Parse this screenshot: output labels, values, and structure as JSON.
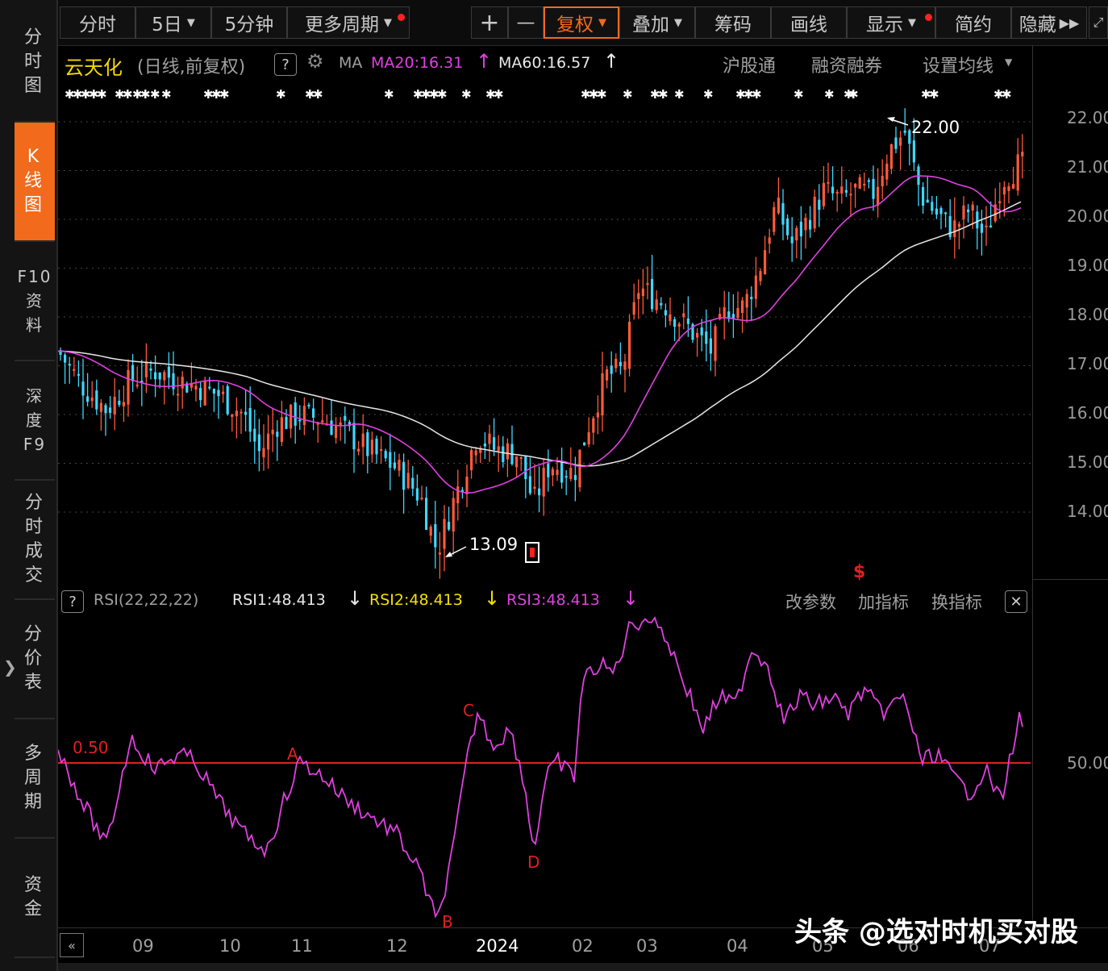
{
  "sidebar": {
    "items": [
      {
        "label": "分时图"
      },
      {
        "label": "K线图"
      },
      {
        "label": "F10资料"
      },
      {
        "label": "深度F9"
      },
      {
        "label": "分时成交"
      },
      {
        "label": "分价表"
      },
      {
        "label": "多周期"
      },
      {
        "label": "资金"
      }
    ]
  },
  "toolbar": {
    "fenshi": "分时",
    "five_day": "5日",
    "five_min": "5分钟",
    "more_period": "更多周期",
    "zoom_in": "+",
    "zoom_out": "—",
    "fuquan": "复权",
    "overlay": "叠加",
    "chips": "筹码",
    "draw": "画线",
    "display": "显示",
    "simple": "简约",
    "hide": "隐藏"
  },
  "info": {
    "stock_name": "云天化",
    "mode": "(日线,前复权)",
    "help": "?",
    "ma_label": "MA",
    "ma20": "MA20:16.31",
    "ma60": "MA60:16.57",
    "hgt": "沪股通",
    "margin": "融资融券",
    "set_ma": "设置均线"
  },
  "rsi": {
    "help": "?",
    "params": "RSI(22,22,22)",
    "rsi1": "RSI1:48.413",
    "rsi2": "RSI2:48.413",
    "rsi3": "RSI3:48.413",
    "edit_params": "改参数",
    "add_indicator": "加指标",
    "change_indicator": "换指标",
    "ref_label": "0.50"
  },
  "y_axis": {
    "price_labels": [
      "22.00",
      "21.00",
      "20.00",
      "19.00",
      "18.00",
      "17.00",
      "16.00",
      "15.00",
      "14.00"
    ],
    "rsi_label": "50.00"
  },
  "x_axis": {
    "labels": [
      "09",
      "10",
      "11",
      "12",
      "2024",
      "02",
      "03",
      "04",
      "05",
      "06",
      "07"
    ]
  },
  "chart_data": {
    "type": "candlestick",
    "high_annotation": "22.00",
    "low_annotation": "13.09",
    "price_ylim": [
      13.0,
      22.5
    ],
    "rsi_points": [
      {
        "label": "A"
      },
      {
        "label": "B"
      },
      {
        "label": "C"
      },
      {
        "label": "D"
      }
    ]
  },
  "colors": {
    "up": "#ff5a3a",
    "down": "#3fd7ff",
    "ma20": "#e040e0",
    "ma60": "#e8e8e8",
    "rsi_line": "#e040e0",
    "ref_line": "#e02020",
    "accent": "#f26a1b"
  },
  "watermark": "头条 @选对时机买对股"
}
